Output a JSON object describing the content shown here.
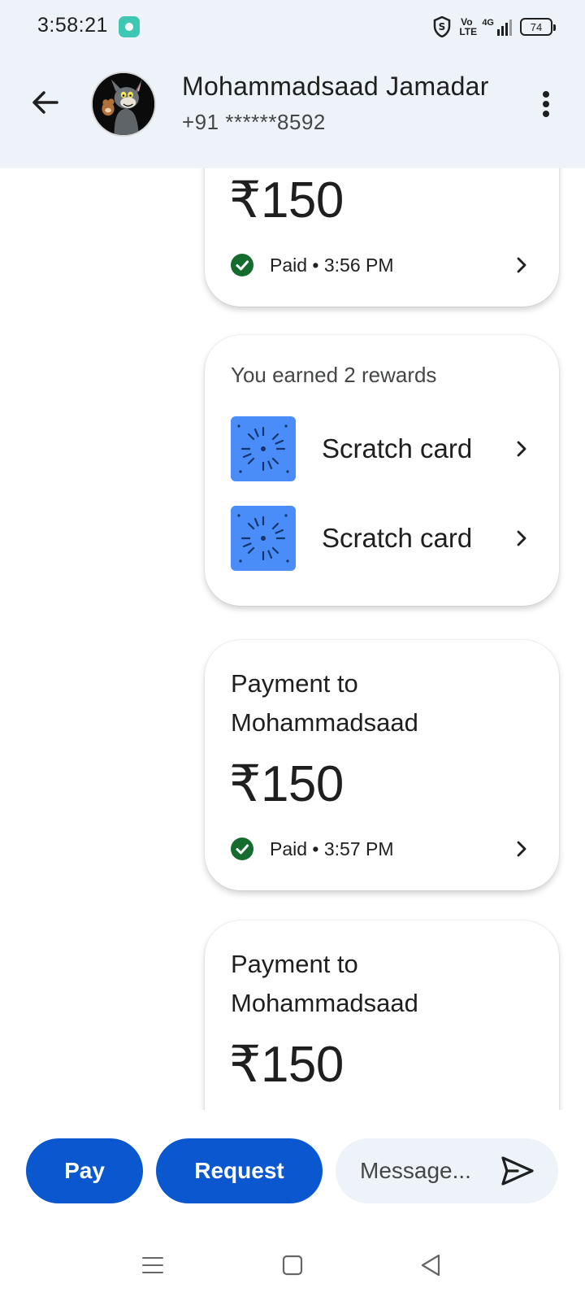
{
  "status_bar": {
    "time": "3:58:21",
    "network_label": "4G",
    "volte_label": "Vo LTE",
    "battery": "74"
  },
  "header": {
    "contact_name": "Mohammadsaad Jamadar",
    "phone": "+91 ******8592"
  },
  "messages": [
    {
      "type": "payment",
      "amount": "₹150",
      "status": "Paid • 3:56 PM"
    },
    {
      "type": "rewards",
      "title": "You earned 2 rewards",
      "items": [
        {
          "label": "Scratch card"
        },
        {
          "label": "Scratch card"
        }
      ]
    },
    {
      "type": "payment",
      "title_line1": "Payment to",
      "title_line2": "Mohammadsaad",
      "amount": "₹150",
      "status": "Paid • 3:57 PM"
    },
    {
      "type": "payment",
      "title_line1": "Payment to",
      "title_line2": "Mohammadsaad",
      "amount": "₹150"
    }
  ],
  "actions": {
    "pay_label": "Pay",
    "request_label": "Request",
    "message_placeholder": "Message..."
  },
  "colors": {
    "primary": "#0b57d0",
    "paid_green": "#146c2e",
    "scratch_blue": "#4b8df8",
    "header_bg": "#eef2f9"
  },
  "icons": [
    "back-arrow-icon",
    "more-vert-icon",
    "check-circle-icon",
    "chevron-right-icon",
    "scratch-card-icon",
    "send-icon",
    "menu-icon",
    "home-icon",
    "nav-back-icon"
  ]
}
